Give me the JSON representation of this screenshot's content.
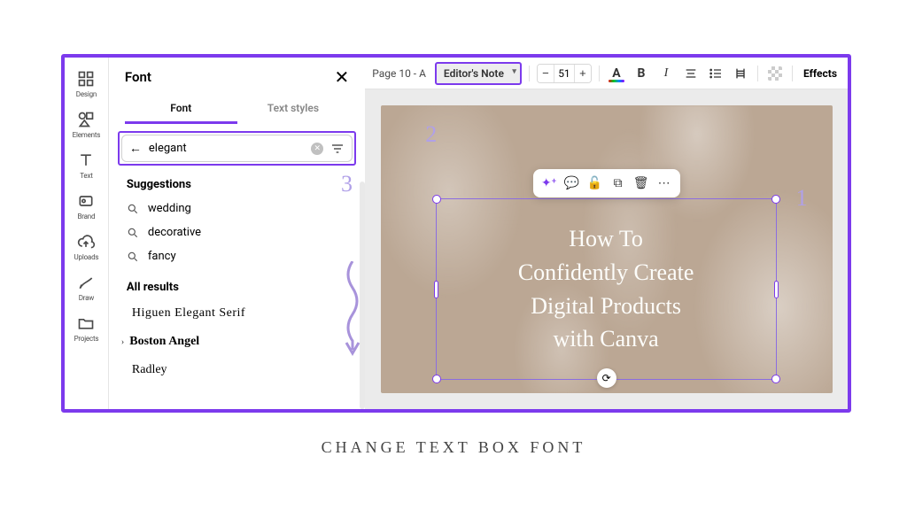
{
  "rail": {
    "items": [
      {
        "label": "Design"
      },
      {
        "label": "Elements"
      },
      {
        "label": "Text"
      },
      {
        "label": "Brand"
      },
      {
        "label": "Uploads"
      },
      {
        "label": "Draw"
      },
      {
        "label": "Projects"
      }
    ]
  },
  "panel": {
    "title": "Font",
    "tabs": [
      "Font",
      "Text styles"
    ],
    "activeTab": 0,
    "search": {
      "value": "elegant"
    },
    "suggestionsHeader": "Suggestions",
    "suggestions": [
      "wedding",
      "decorative",
      "fancy"
    ],
    "resultsHeader": "All results",
    "results": [
      "Higuen Elegant Serif",
      "Boston Angel",
      "Radley"
    ]
  },
  "topbar": {
    "pagePrefix": "Page 10 - A",
    "fontSelected": "Editor's Note",
    "fontSize": "51",
    "colorLetter": "A",
    "bold": "B",
    "italic": "I",
    "effects": "Effects"
  },
  "art": {
    "line1": "How To",
    "line2": "Confidently Create",
    "line3": "Digital Products",
    "line4": "with Canva"
  },
  "annotations": {
    "one": "1",
    "two": "2",
    "three": "3"
  },
  "caption": "CHANGE TEXT BOX FONT"
}
